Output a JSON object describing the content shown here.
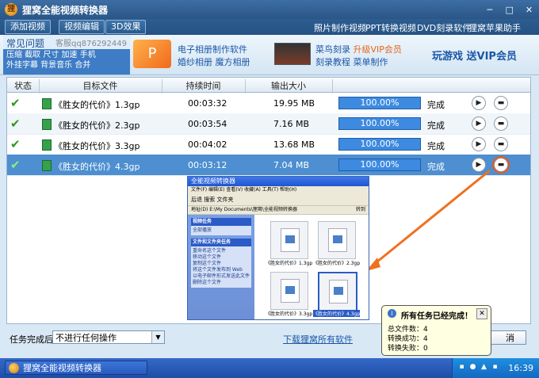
{
  "window": {
    "title": "狸窝全能视频转换器"
  },
  "menubar": {
    "tabs": [
      "添加视频",
      "视频编辑",
      "3D效果"
    ],
    "right_links": [
      "照片制作视频",
      "PPT转换视频",
      "DVD刻录软件",
      "狸窝苹果助手"
    ]
  },
  "promo": {
    "faq_title": "常见问题",
    "faq_qq": "客服qq876292449",
    "faq_links_line1": "压缩 截取 尺寸 加速 手机",
    "faq_links_line2": "外挂字幕 背景音乐 合并",
    "album_line1": "电子相册制作软件",
    "album_line2": "婚纱相册 魔方相册",
    "burn_line1a": "菜鸟刻录",
    "burn_line1b": "升级VIP会员",
    "burn_line2": "刻录教程 菜单制作",
    "vip": "玩游戏 送VIP会员"
  },
  "table": {
    "headers": {
      "status": "状态",
      "file": "目标文件",
      "duration": "持续时间",
      "size": "输出大小"
    },
    "rows": [
      {
        "file": "《胜女的代价》1.3gp",
        "duration": "00:03:32",
        "size": "19.95 MB",
        "progress": "100.00%",
        "status": "完成"
      },
      {
        "file": "《胜女的代价》2.3gp",
        "duration": "00:03:54",
        "size": "7.16 MB",
        "progress": "100.00%",
        "status": "完成"
      },
      {
        "file": "《胜女的代价》3.3gp",
        "duration": "00:04:02",
        "size": "13.68 MB",
        "progress": "100.00%",
        "status": "完成"
      },
      {
        "file": "《胜女的代价》4.3gp",
        "duration": "00:03:12",
        "size": "7.04 MB",
        "progress": "100.00%",
        "status": "完成"
      }
    ]
  },
  "explorer": {
    "title": "全能视频转换器",
    "menu": "文件(F)  编辑(E)  查看(V)  收藏(A)  工具(T)  帮助(H)",
    "toolbar": "后退  搜索  文件夹",
    "address_label": "地址(D)",
    "address": "E:\\My Documents\\狸窝\\全能视频转换器",
    "go": "转到",
    "task_title": "视频任务",
    "task_item": "全部播放",
    "file_task_title": "文件和文件夹任务",
    "file_tasks": [
      "重命名这个文件",
      "移动这个文件",
      "复制这个文件",
      "将这个文件发布到 Web",
      "以电子邮件形式发送此文件",
      "删除这个文件"
    ],
    "thumbs": [
      "《胜女的代价》1.3gp",
      "《胜女的代价》2.3gp",
      "《胜女的代价》3.3gp",
      "《胜女的代价》4.3gp"
    ]
  },
  "notify": {
    "title": "所有任务已经完成！",
    "total": "总文件数：4",
    "success": "转换成功：4",
    "fail": "转换失败：0"
  },
  "bottom": {
    "after_label": "任务完成后:",
    "after_value": "不进行任何操作",
    "download_link": "下载狸窝所有软件",
    "cancel": "消"
  },
  "taskbar": {
    "app": "狸窝全能视频转换器",
    "clock": "16:39"
  },
  "colors": {
    "accent": "#e8641c",
    "progress": "#3d8ae0",
    "selected_row": "#4d8fd0"
  }
}
